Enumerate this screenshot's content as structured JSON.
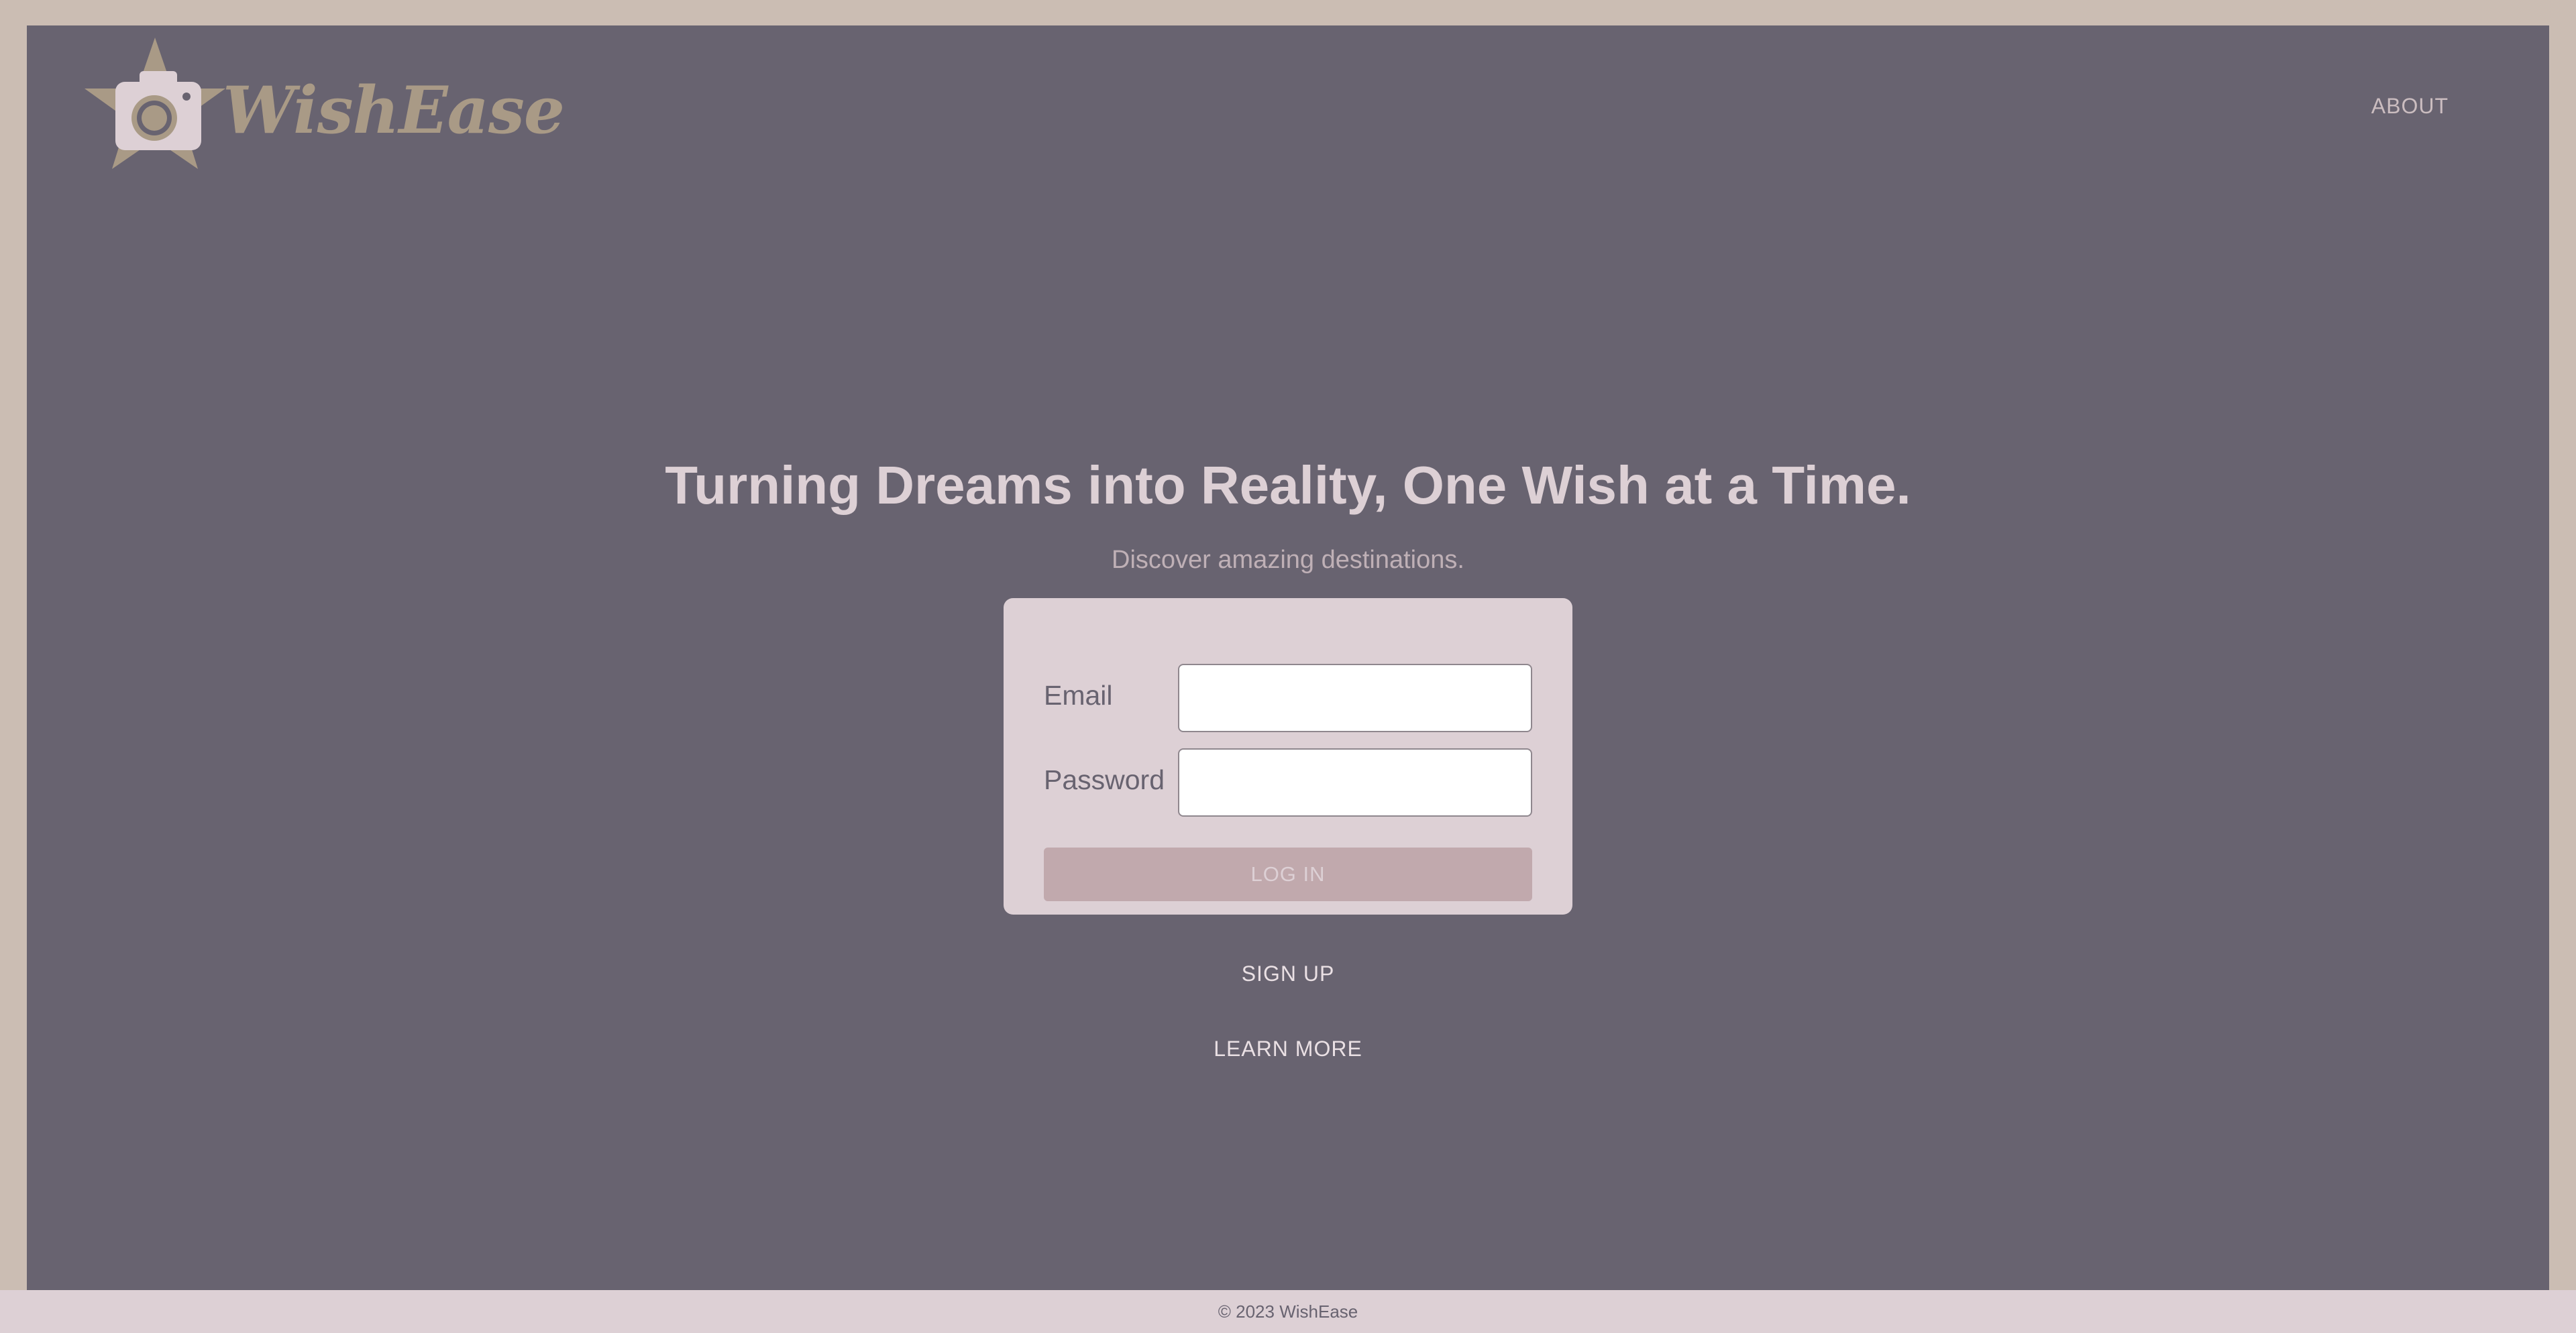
{
  "brand": {
    "name": "WishEase"
  },
  "nav": {
    "about_label": "ABOUT"
  },
  "hero": {
    "title": "Turning Dreams into Reality, One Wish at a Time.",
    "subtitle": "Discover amazing destinations."
  },
  "login_form": {
    "email_label": "Email",
    "email_value": "",
    "password_label": "Password",
    "password_value": "",
    "submit_label": "LOG IN"
  },
  "links": {
    "signup_label": "SIGN UP",
    "learn_more_label": "LEARN MORE"
  },
  "footer": {
    "copyright": "© 2023 WishEase"
  },
  "colors": {
    "outer_border": "#cbbdb3",
    "main_background": "#686370",
    "card_background": "#ddd0d5",
    "button_background": "#c1a9ad",
    "logo_accent": "#a99a86"
  },
  "icons": {
    "logo": "star-camera-icon"
  }
}
